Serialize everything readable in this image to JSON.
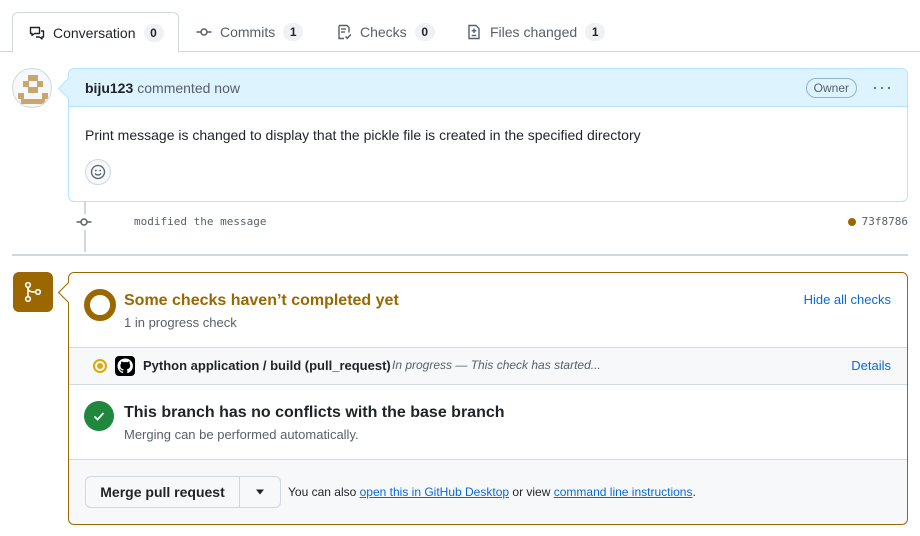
{
  "tabs": [
    {
      "label": "Conversation",
      "count": "0",
      "icon": "comment-discussion-icon"
    },
    {
      "label": "Commits",
      "count": "1",
      "icon": "git-commit-icon"
    },
    {
      "label": "Checks",
      "count": "0",
      "icon": "checklist-icon"
    },
    {
      "label": "Files changed",
      "count": "1",
      "icon": "file-diff-icon"
    }
  ],
  "comment": {
    "author": "biju123",
    "time": "commented now",
    "badge": "Owner",
    "menu": "···",
    "body": "Print message is changed to display that the pickle file is created in the specified directory"
  },
  "commit": {
    "message": "modified the message",
    "sha": "73f8786",
    "status_color": "#9a6700"
  },
  "checks": {
    "title": "Some checks haven’t completed yet",
    "subtitle": "1 in progress check",
    "hide_label": "Hide all checks",
    "items": [
      {
        "name": "Python application / build (pull_request)",
        "status": "In progress — This check has started...",
        "details": "Details"
      }
    ]
  },
  "conflicts": {
    "title": "This branch has no conflicts with the base branch",
    "subtitle": "Merging can be performed automatically."
  },
  "merge": {
    "button": "Merge pull request",
    "hint_prefix": "You can also",
    "desktop_link": "open this in GitHub Desktop",
    "hint_middle": "or view",
    "cli_link": "command line instructions",
    "hint_suffix": "."
  },
  "colors": {
    "pending": "#9a6700",
    "success": "#1f883d",
    "link": "#0969da",
    "comment_header": "#ddf4ff"
  }
}
